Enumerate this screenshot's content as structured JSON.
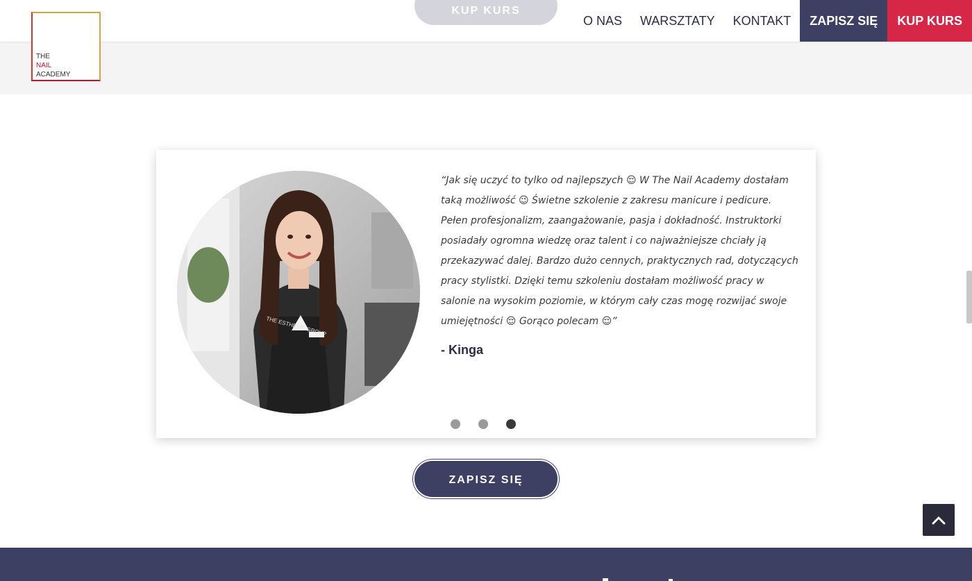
{
  "brand": {
    "logo_line1": "THE",
    "logo_line2": "NAIL",
    "logo_line3": "ACADEMY",
    "accent_red": "#d62747",
    "accent_navy": "#3d3f63"
  },
  "header": {
    "ghost_button_label": "KUP KURS",
    "nav": [
      {
        "label": "O NAS"
      },
      {
        "label": "WARSZTATY"
      },
      {
        "label": "KONTAKT"
      },
      {
        "label": "ZAPISZ SIĘ"
      },
      {
        "label": "KUP KURS"
      }
    ]
  },
  "testimonial": {
    "quote": "“Jak się uczyć to tylko od najlepszych 😌 W The Nail Academy dostałam taką możliwość 😉 Świetne szkolenie z zakresu manicure i pedicure. Pełen profesjonalizm, zaangażowanie, pasja i dokładność. Instruktorki posiadały ogromna wiedzę oraz talent i co najważniejsze chciały ją przekazywać dalej. Bardzo dużo cennych, praktycznych rad, dotyczących pracy stylistki. Dzięki temu szkoleniu dostałam możliwość pracy w salonie na wysokim poziomie, w którym cały czas mogę rozwijać swoje umiejętności 😌 Gorąco polecam 😌”",
    "author": "- Kinga",
    "apron_text": "THE ESTHETIC GROUP",
    "slides_total": 3,
    "slide_active": 3
  },
  "cta": {
    "label": "ZAPISZ SIĘ"
  },
  "icons": {
    "back_to_top": "chevron-up-icon"
  }
}
